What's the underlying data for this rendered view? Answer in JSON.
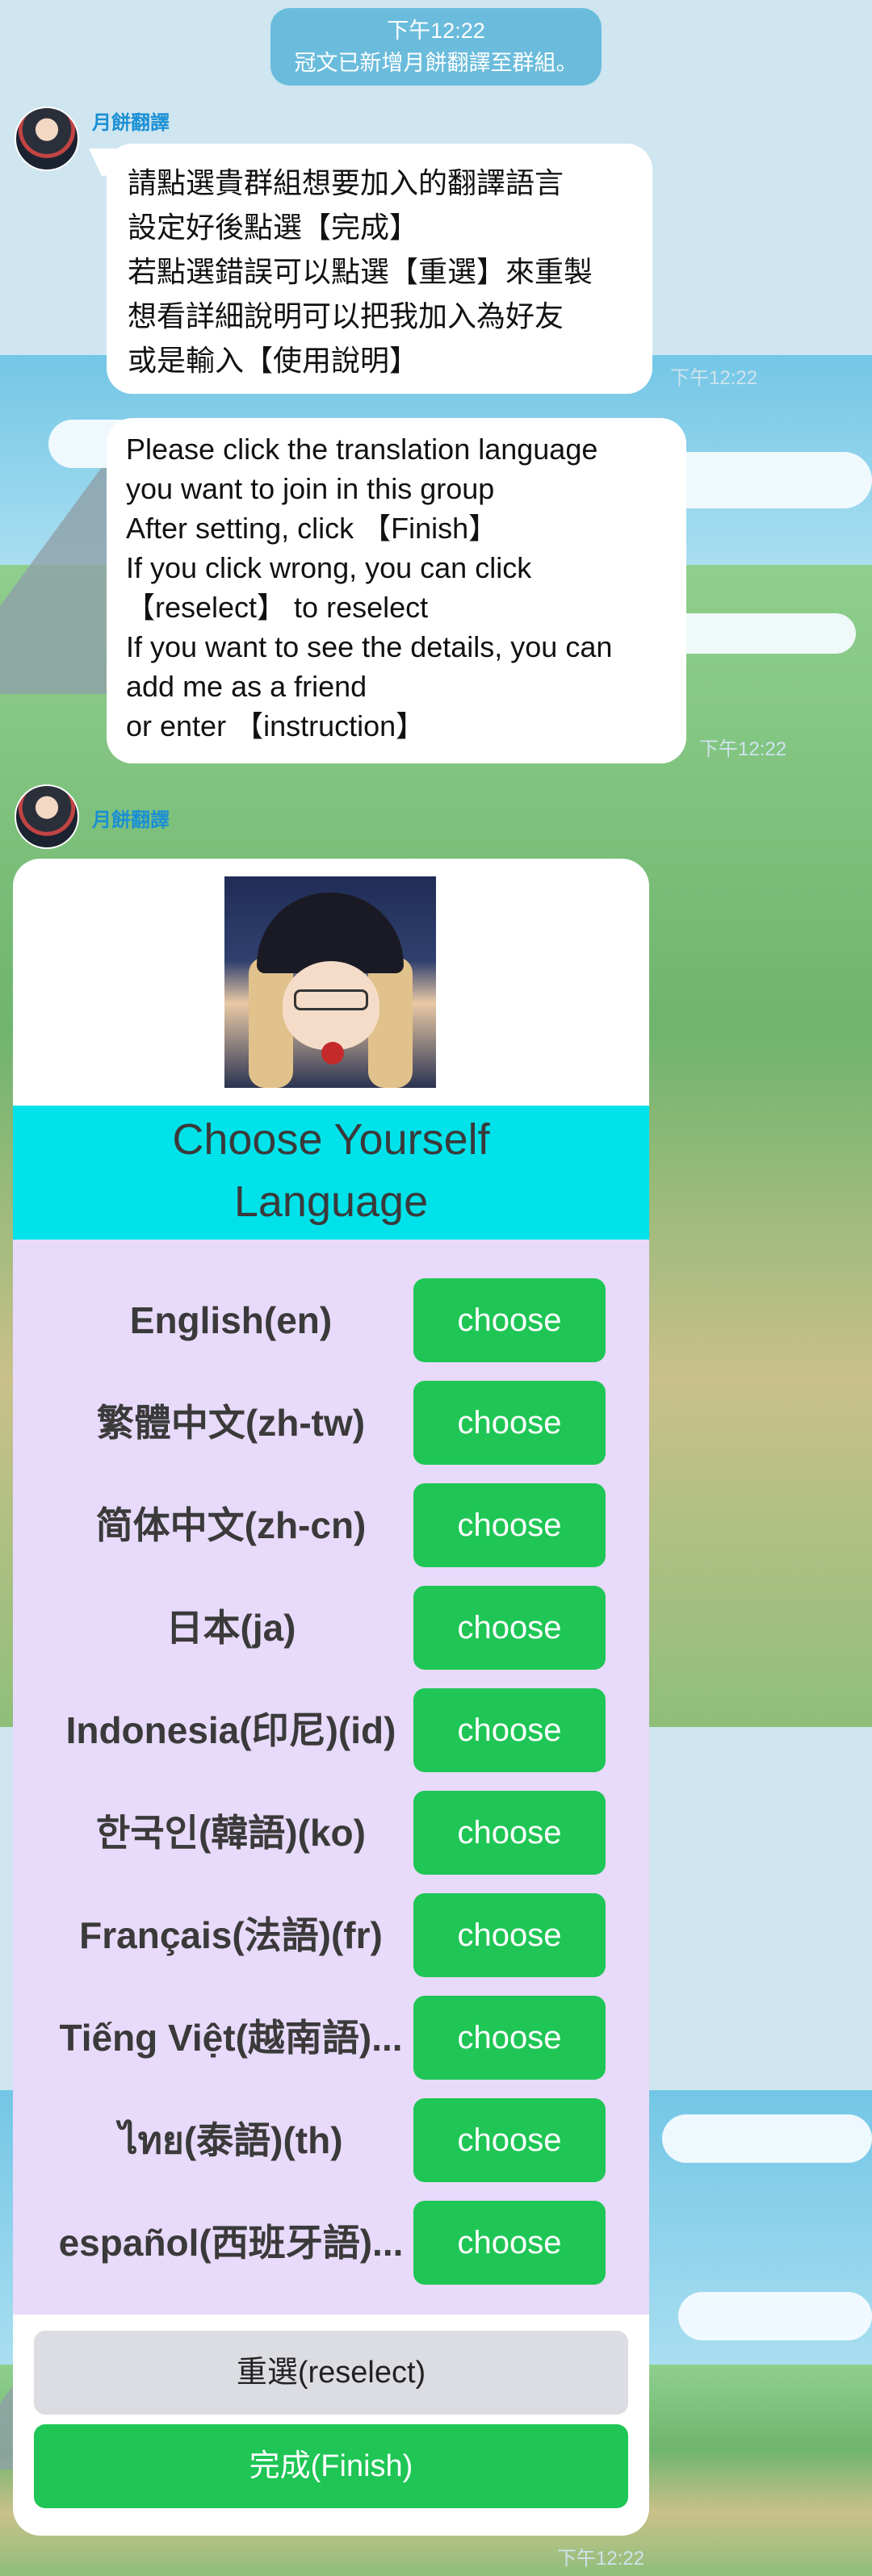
{
  "system_message": {
    "time": "下午12:22",
    "text": "冠文已新增月餅翻譯至群組。"
  },
  "messages": [
    {
      "sender": "月餅翻譯",
      "lines": [
        "請點選貴群組想要加入的翻譯語言",
        "設定好後點選【完成】",
        "若點選錯誤可以點選【重選】來重製",
        "想看詳細說明可以把我加入為好友",
        "或是輸入【使用說明】"
      ],
      "time": "下午12:22"
    },
    {
      "lines": [
        "Please click the translation language",
        "you want to join in this group",
        "After setting, click 【Finish】",
        "If you click wrong, you can click",
        "【reselect】 to reselect",
        "If you want to see the details, you can",
        "add me as a friend",
        "or enter 【instruction】"
      ],
      "time": "下午12:22"
    }
  ],
  "card": {
    "sender": "月餅翻譯",
    "title_lines": [
      "Choose Yourself",
      "Language"
    ],
    "languages": [
      {
        "label": "English(en)",
        "button": "choose"
      },
      {
        "label": "繁體中文(zh-tw)",
        "button": "choose"
      },
      {
        "label": "简体中文(zh-cn)",
        "button": "choose"
      },
      {
        "label": "日本(ja)",
        "button": "choose"
      },
      {
        "label": "Indonesia(印尼)(id)",
        "button": "choose"
      },
      {
        "label": "한국인(韓語)(ko)",
        "button": "choose"
      },
      {
        "label": "Français(法語)(fr)",
        "button": "choose"
      },
      {
        "label": "Tiếng Việt(越南語)...",
        "button": "choose"
      },
      {
        "label": "ไทย(泰語)(th)",
        "button": "choose"
      },
      {
        "label": "español(西班牙語)...",
        "button": "choose"
      }
    ],
    "reselect_label": "重選(reselect)",
    "finish_label": "完成(Finish)",
    "time": "下午12:22"
  },
  "colors": {
    "accent_green": "#1fc655",
    "title_band": "#00e2ea",
    "list_bg": "#e8dafa",
    "sender_blue": "#1a8fd4"
  }
}
